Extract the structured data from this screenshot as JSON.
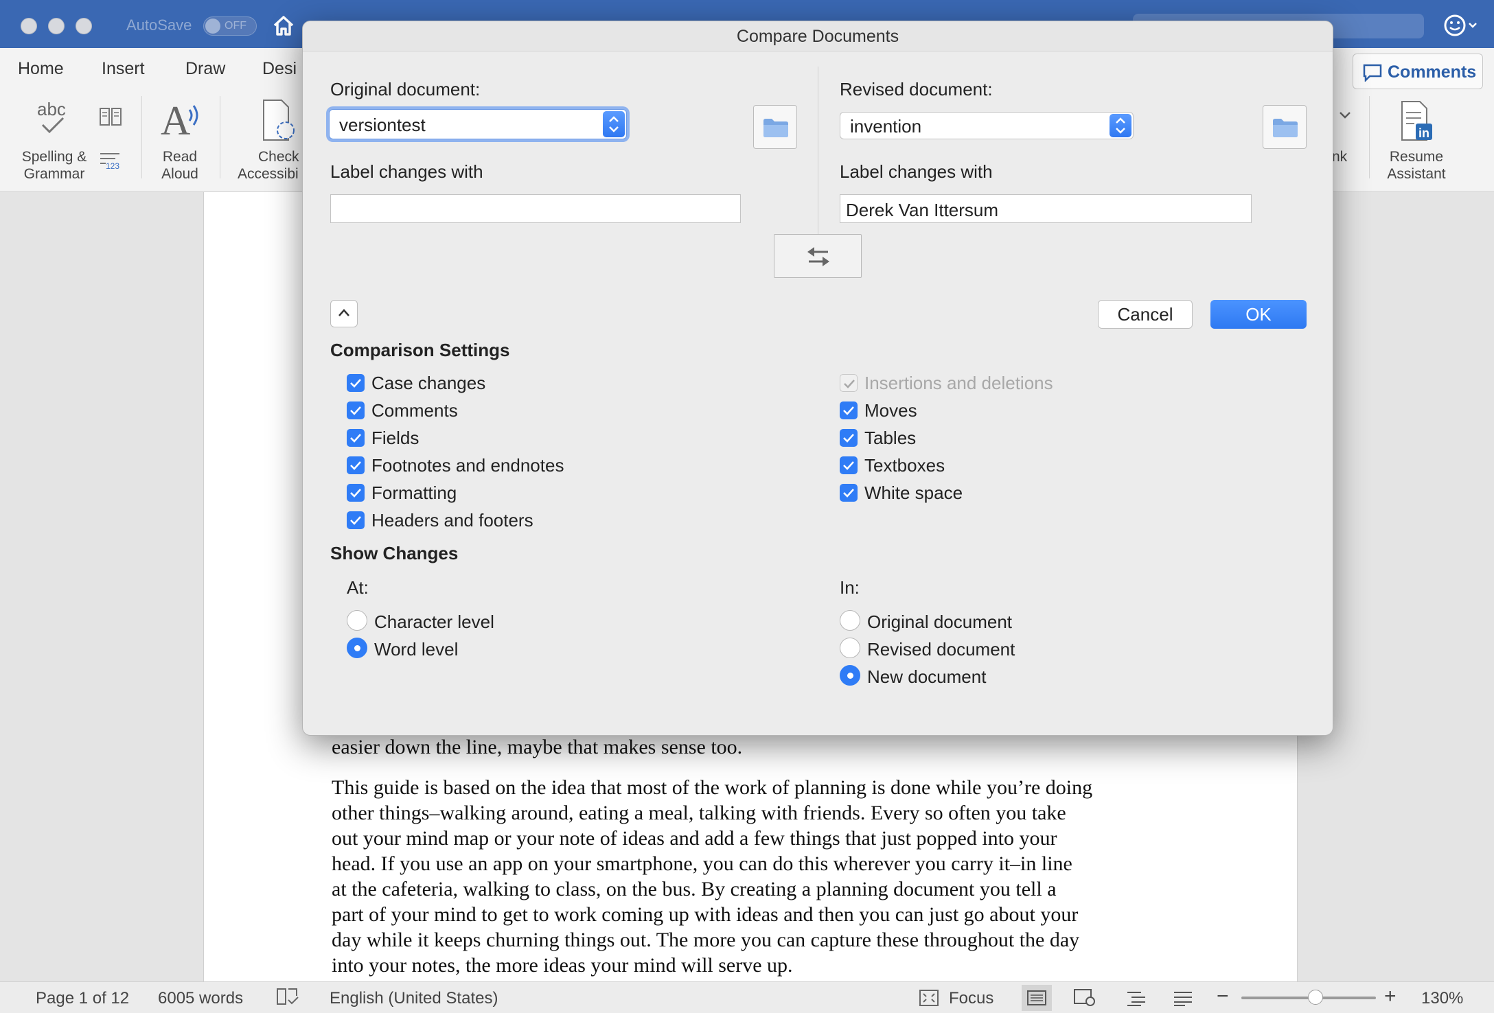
{
  "titlebar": {
    "autosave_label": "AutoSave",
    "autosave_state": "OFF"
  },
  "ribbon": {
    "tabs": [
      "Home",
      "Insert",
      "Draw",
      "Desi"
    ],
    "spelling_label": "Spelling &",
    "spelling_label2": "Grammar",
    "read_aloud_label": "Read",
    "read_aloud_label2": "Aloud",
    "check_label": "Check",
    "check_label2": "Accessibi",
    "link_fragment": "nk",
    "resume_label": "Resume",
    "resume_label2": "Assistant",
    "comments_label": "Comments"
  },
  "dialog": {
    "title": "Compare Documents",
    "original_label": "Original document:",
    "original_value": "versiontest",
    "revised_label": "Revised document:",
    "revised_value": "invention",
    "label_changes_left": "Label changes with",
    "label_changes_left_value": "",
    "label_changes_right": "Label changes with",
    "label_changes_right_value": "Derek Van Ittersum",
    "cancel_label": "Cancel",
    "ok_label": "OK",
    "comparison_title": "Comparison Settings",
    "left_settings": [
      {
        "label": "Case changes",
        "checked": true
      },
      {
        "label": "Comments",
        "checked": true
      },
      {
        "label": "Fields",
        "checked": true
      },
      {
        "label": "Footnotes and endnotes",
        "checked": true
      },
      {
        "label": "Formatting",
        "checked": true
      },
      {
        "label": "Headers and footers",
        "checked": true
      }
    ],
    "right_settings": [
      {
        "label": "Insertions and deletions",
        "checked": true,
        "disabled": true
      },
      {
        "label": "Moves",
        "checked": true
      },
      {
        "label": "Tables",
        "checked": true
      },
      {
        "label": "Textboxes",
        "checked": true
      },
      {
        "label": "White space",
        "checked": true
      }
    ],
    "show_changes_title": "Show Changes",
    "at_label": "At:",
    "at_options": [
      {
        "label": "Character level",
        "selected": false
      },
      {
        "label": "Word level",
        "selected": true
      }
    ],
    "in_label": "In:",
    "in_options": [
      {
        "label": "Original document",
        "selected": false
      },
      {
        "label": "Revised document",
        "selected": false
      },
      {
        "label": "New document",
        "selected": true
      }
    ]
  },
  "document": {
    "para1": "easier down the line, maybe that makes sense too.",
    "para2_lines": [
      "This guide is based on the idea that most of the work of planning is done while you’re doing",
      "other things–walking around, eating a meal, talking with friends. Every so often you take",
      "out your mind map or your note of ideas and add a few things that just popped into your",
      "head. If you use an app on your smartphone, you can do this wherever you carry it–in line",
      "at the cafeteria, walking to class, on the bus. By creating a planning document you tell a",
      "part of your mind to get to work coming up with ideas and then you can just go about your",
      "day while it keeps churning things out. The more you can capture these throughout the day",
      "into your notes, the more ideas your mind will serve up."
    ]
  },
  "statusbar": {
    "page": "Page 1 of 12",
    "words": "6005 words",
    "language": "English (United States)",
    "focus": "Focus",
    "zoom": "130%",
    "zoom_fraction": 0.55
  },
  "colors": {
    "titlebar": "#3a68b3",
    "accent": "#2f7cf6"
  }
}
